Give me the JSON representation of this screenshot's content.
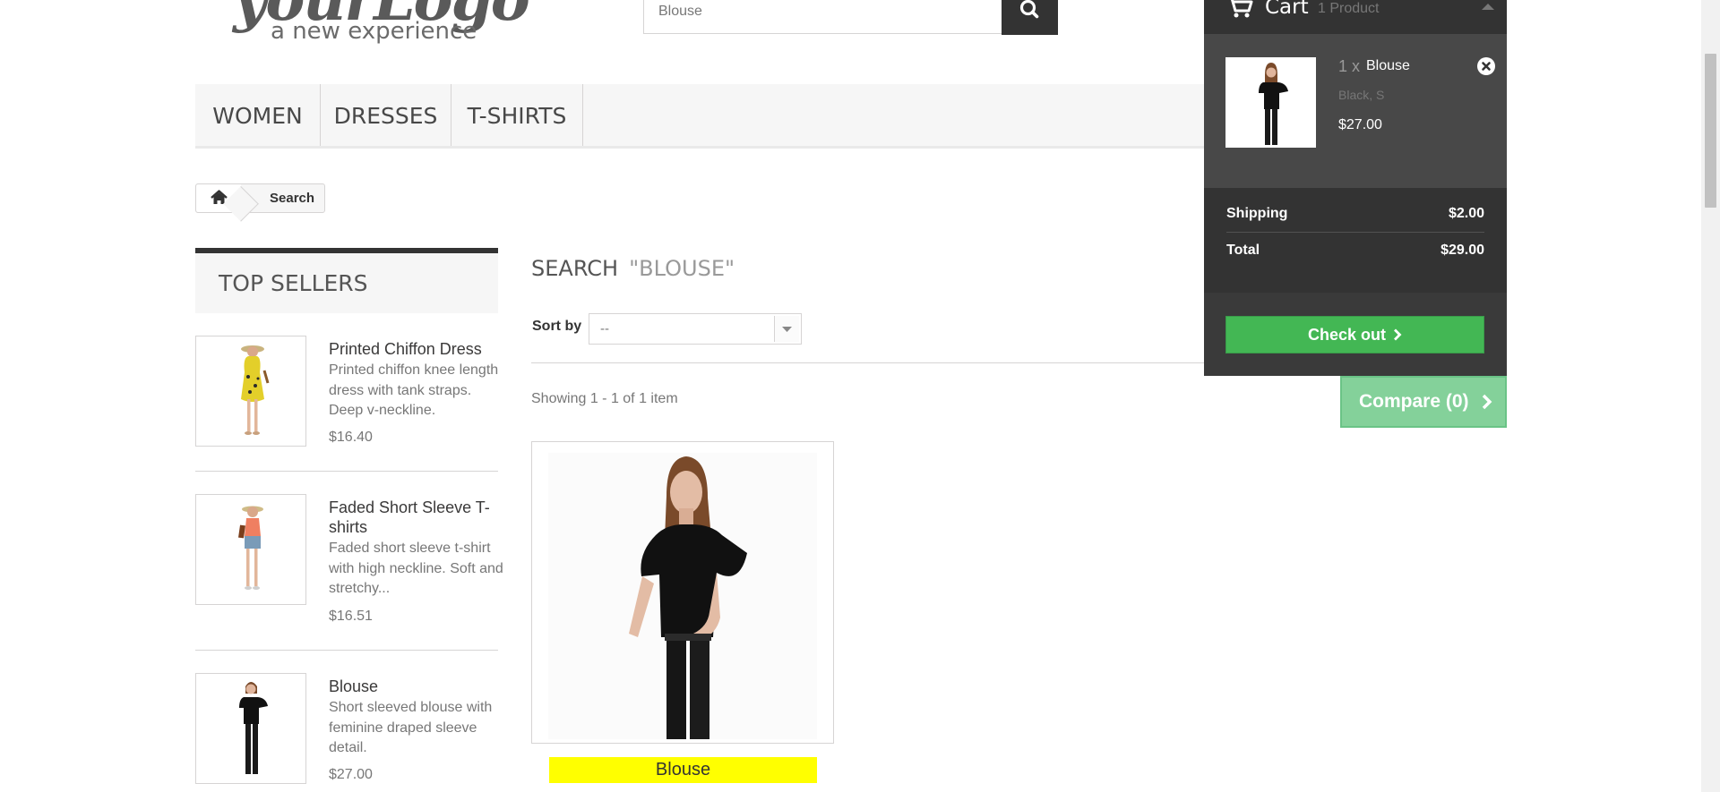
{
  "logo": {
    "title": "yourLogo",
    "tagline": "a new experience"
  },
  "search": {
    "value": "Blouse"
  },
  "nav": {
    "items": [
      "WOMEN",
      "DRESSES",
      "T-SHIRTS"
    ]
  },
  "breadcrumb": {
    "current": "Search"
  },
  "top_sellers": {
    "title": "TOP SELLERS",
    "items": [
      {
        "name": "Printed Chiffon Dress",
        "desc": "Printed chiffon knee length dress with tank straps. Deep v-neckline.",
        "price": "$16.40"
      },
      {
        "name": "Faded Short Sleeve T-shirts",
        "desc": "Faded short sleeve t-shirt with high neckline. Soft and stretchy...",
        "price": "$16.51"
      },
      {
        "name": "Blouse",
        "desc": "Short sleeved blouse with feminine draped sleeve detail.",
        "price": "$27.00"
      }
    ]
  },
  "results": {
    "heading": "SEARCH",
    "query": "\"BLOUSE\"",
    "sort_label": "Sort by",
    "sort_value": "--",
    "showing": "Showing 1 - 1 of 1 item",
    "product_name": "Blouse"
  },
  "compare": {
    "label": "Compare (0)"
  },
  "cart": {
    "title": "Cart",
    "count": "1 Product",
    "item": {
      "qty": "1 x",
      "name": "Blouse",
      "attributes": "Black, S",
      "price": "$27.00"
    },
    "shipping_label": "Shipping",
    "shipping_value": "$2.00",
    "total_label": "Total",
    "total_value": "$29.00",
    "checkout_label": "Check out"
  },
  "colors": {
    "accent_green": "#43b754",
    "cart_bg": "#333333",
    "highlight": "#ffff00"
  }
}
